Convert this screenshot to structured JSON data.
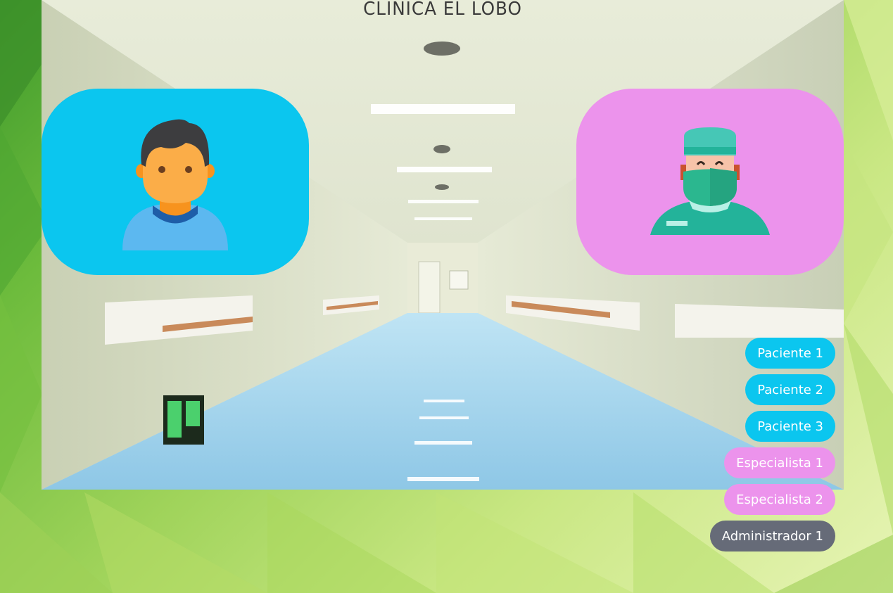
{
  "header": {
    "title": "CLINICA EL LOBO"
  },
  "cards": {
    "patient": {
      "icon": "patient-avatar-icon",
      "color": "#0bc6ef"
    },
    "specialist": {
      "icon": "surgeon-avatar-icon",
      "color": "#ec93ec"
    }
  },
  "menu": {
    "items": [
      {
        "label": "Paciente 1",
        "role": "patient"
      },
      {
        "label": "Paciente 2",
        "role": "patient"
      },
      {
        "label": "Paciente 3",
        "role": "patient"
      },
      {
        "label": "Especialista 1",
        "role": "specialist"
      },
      {
        "label": "Especialista 2",
        "role": "specialist"
      },
      {
        "label": "Administrador 1",
        "role": "admin"
      }
    ]
  },
  "colors": {
    "patient": "#0bc6ef",
    "specialist": "#ec93ec",
    "admin": "#666b78"
  }
}
